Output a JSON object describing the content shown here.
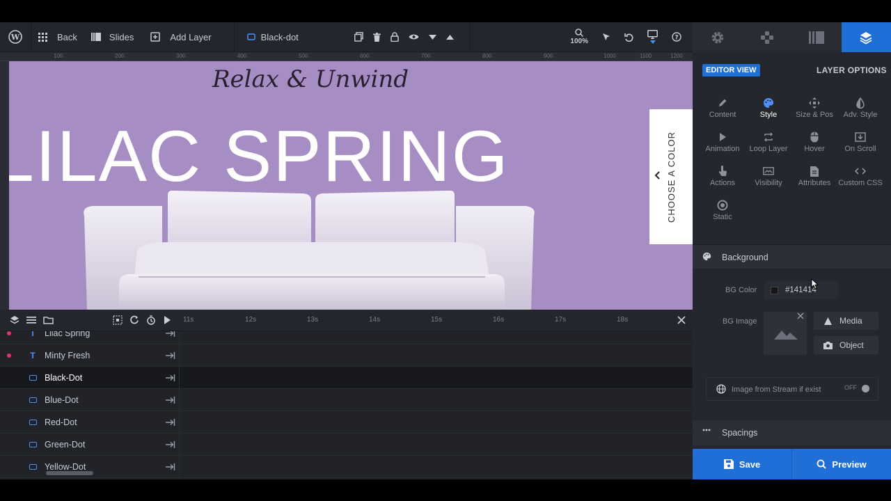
{
  "toolbar": {
    "back_label": "Back",
    "slides_label": "Slides",
    "add_layer_label": "Add Layer",
    "current_layer_name": "Black-dot",
    "zoom_level": "100%"
  },
  "ruler": {
    "ticks": [
      "100",
      "200",
      "300",
      "400",
      "500",
      "600",
      "700",
      "800",
      "900",
      "1000",
      "1100",
      "1200"
    ]
  },
  "canvas": {
    "headline": "Relax & Unwind",
    "title": "LILAC SPRING",
    "choose_color_label": "CHOOSE A COLOR",
    "background_color": "#a68dc4"
  },
  "timeline": {
    "times": [
      "11s",
      "12s",
      "13s",
      "14s",
      "15s",
      "16s",
      "17s",
      "18s"
    ]
  },
  "layers": [
    {
      "name": "Lilac Spring",
      "type": "text",
      "marked": true
    },
    {
      "name": "Minty Fresh",
      "type": "text",
      "marked": true
    },
    {
      "name": "Black-Dot",
      "type": "shape",
      "selected": true
    },
    {
      "name": "Blue-Dot",
      "type": "shape"
    },
    {
      "name": "Red-Dot",
      "type": "shape"
    },
    {
      "name": "Green-Dot",
      "type": "shape"
    },
    {
      "name": "Yellow-Dot",
      "type": "shape"
    }
  ],
  "panel": {
    "editor_view_label": "EDITOR VIEW",
    "layer_options_label": "LAYER OPTIONS",
    "options": [
      {
        "label": "Content",
        "icon": "pencil-icon"
      },
      {
        "label": "Style",
        "icon": "palette-icon",
        "active": true
      },
      {
        "label": "Size & Pos",
        "icon": "move-icon"
      },
      {
        "label": "Adv. Style",
        "icon": "contrast-icon"
      },
      {
        "label": "Animation",
        "icon": "play-icon"
      },
      {
        "label": "Loop Layer",
        "icon": "loop-icon"
      },
      {
        "label": "Hover",
        "icon": "mouse-icon"
      },
      {
        "label": "On Scroll",
        "icon": "scroll-icon"
      },
      {
        "label": "Actions",
        "icon": "pointer-icon"
      },
      {
        "label": "Visibility",
        "icon": "visibility-icon"
      },
      {
        "label": "Attributes",
        "icon": "document-icon"
      },
      {
        "label": "Custom CSS",
        "icon": "code-icon"
      },
      {
        "label": "Static",
        "icon": "target-icon"
      }
    ],
    "background_section_title": "Background",
    "bg_color_label": "BG Color",
    "bg_color_value": "#141414",
    "bg_image_label": "BG Image",
    "media_label": "Media",
    "object_label": "Object",
    "stream_label": "Image from Stream if exist",
    "stream_toggle_label": "OFF",
    "spacings_section_title": "Spacings"
  },
  "footer": {
    "save_label": "Save",
    "preview_label": "Preview"
  },
  "colors": {
    "accent": "#1f6fd6",
    "marker": "#e2336f"
  }
}
